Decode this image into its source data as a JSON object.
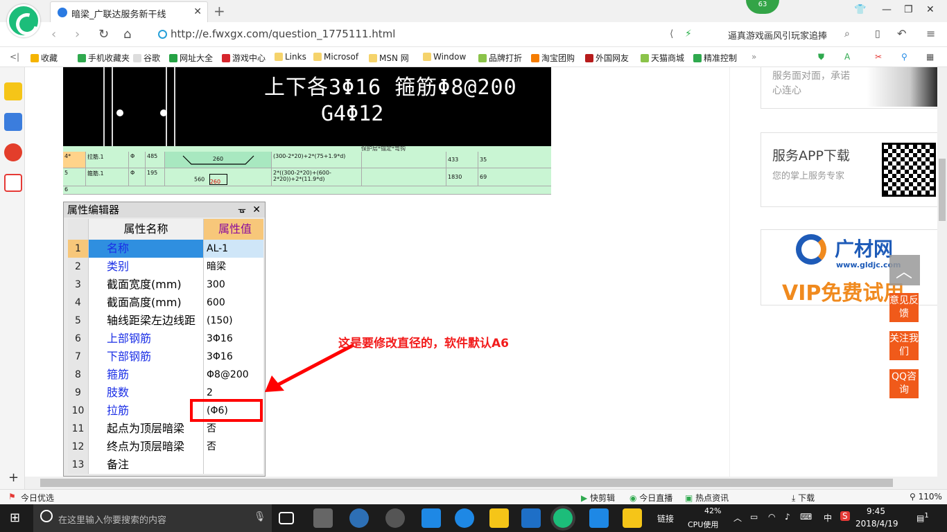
{
  "browser": {
    "tab_title": "暗梁_广联达服务新干线",
    "badge_count": "63",
    "url": "http://e.fwxgx.com/question_1775111.html",
    "search_text": "逼真游戏画风引玩家追捧"
  },
  "bookmarks": [
    "收藏",
    "手机收藏夹",
    "谷歌",
    "网址大全",
    "游戏中心",
    "Links",
    "Microsof",
    "MSN 网",
    "Window",
    "品牌打折",
    "淘宝团购",
    "外国网友",
    "天猫商城",
    "精准控制"
  ],
  "cad": {
    "line1": "上下各3Φ16 箍筋Φ8@200",
    "line2": "G4Φ12"
  },
  "rebar_table": {
    "rows": [
      {
        "no": "4*",
        "name": "拉筋.1",
        "grade": "Φ",
        "dia": "485",
        "shape_val": "260",
        "formula": "(300-2*20)+2*(75+1.9*d)",
        "len": "433",
        "count": "35"
      },
      {
        "no": "5",
        "name": "箍筋.1",
        "grade": "Φ",
        "dia": "195",
        "shape_val": "560",
        "shape_val2": "260",
        "formula": "2*((300-2*20)+(600-2*20))+2*(11.9*d)",
        "len": "1830",
        "count": "69"
      },
      {
        "no": "6",
        "name": "",
        "grade": "",
        "dia": "",
        "shape_val": "",
        "formula": "",
        "len": "",
        "count": ""
      }
    ],
    "header_hint": "保护层*锚定*弯钩"
  },
  "property_editor": {
    "title": "属性编辑器",
    "col_name": "属性名称",
    "col_value": "属性值",
    "rows": [
      {
        "no": "1",
        "name": "名称",
        "value": "AL-1",
        "blue": true
      },
      {
        "no": "2",
        "name": "类别",
        "value": "暗梁",
        "blue": true
      },
      {
        "no": "3",
        "name": "截面宽度(mm)",
        "value": "300",
        "blue": false
      },
      {
        "no": "4",
        "name": "截面高度(mm)",
        "value": "600",
        "blue": false
      },
      {
        "no": "5",
        "name": "轴线距梁左边线距",
        "value": "(150)",
        "blue": false
      },
      {
        "no": "6",
        "name": "上部钢筋",
        "value": "3Φ16",
        "blue": true
      },
      {
        "no": "7",
        "name": "下部钢筋",
        "value": "3Φ16",
        "blue": true
      },
      {
        "no": "8",
        "name": "箍筋",
        "value": "Φ8@200",
        "blue": true
      },
      {
        "no": "9",
        "name": "肢数",
        "value": "2",
        "blue": true
      },
      {
        "no": "10",
        "name": "拉筋",
        "value": "(Φ6)",
        "blue": true
      },
      {
        "no": "11",
        "name": "起点为顶层暗梁",
        "value": "否",
        "blue": false
      },
      {
        "no": "12",
        "name": "终点为顶层暗梁",
        "value": "否",
        "blue": false
      },
      {
        "no": "13",
        "name": "备注",
        "value": "",
        "blue": false
      }
    ]
  },
  "annotation": "这是要修改直径的，软件默认A6",
  "right_sidebar": {
    "card1_text": "服务面对面，承诺心连心",
    "app_title": "服务APP下载",
    "app_sub": "您的掌上服务专家",
    "ad_logo": "广材网",
    "ad_url": "www.gldjc.com",
    "ad_vip": "VIP免费试用",
    "float_btns": [
      "意见反馈",
      "关注我们",
      "QQ咨询"
    ]
  },
  "statusbar": {
    "left": "今日优选",
    "items": [
      "快剪辑",
      "今日直播",
      "热点资讯",
      "下载"
    ],
    "zoom": "110%"
  },
  "taskbar": {
    "search_placeholder": "在这里输入你要搜索的内容",
    "link_label": "链接",
    "cpu_pct": "42%",
    "cpu_label": "CPU使用",
    "ime": "中",
    "time": "9:45",
    "date": "2018/4/19",
    "notif": "1"
  },
  "colors": {
    "accent_green": "#1cbd7a",
    "cad_bg": "#000000",
    "table_green": "#c9f5d3",
    "highlight_red": "#ff0000",
    "label_blue": "#1a2ee6",
    "float_orange": "#f05a1a"
  }
}
